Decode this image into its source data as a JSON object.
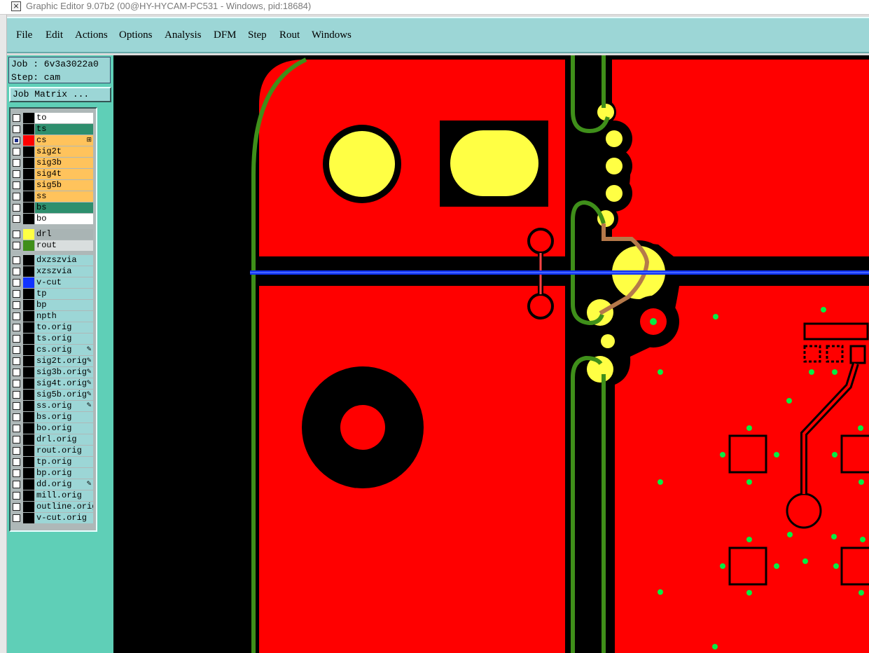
{
  "window": {
    "title": "Graphic Editor 9.07b2 (00@HY-HYCAM-PC531 - Windows, pid:18684)",
    "icon": "editor-icon"
  },
  "menu": [
    "File",
    "Edit",
    "Actions",
    "Options",
    "Analysis",
    "DFM",
    "Step",
    "Rout",
    "Windows"
  ],
  "job": {
    "job_label": "Job : 6v3a3022a0",
    "step_label": "Step: cam",
    "matrix_button": "Job Matrix ..."
  },
  "layers": {
    "board": [
      {
        "name": "to",
        "color": "#ffffff",
        "swatch": "#000000",
        "checked": false
      },
      {
        "name": "ts",
        "color": "#2e8f6e",
        "swatch": "#000000",
        "checked": false
      },
      {
        "name": "cs",
        "color": "#ffc35c",
        "swatch": "#ff0000",
        "checked": true,
        "mark": "⊞"
      },
      {
        "name": "sig2t",
        "color": "#ffc35c",
        "swatch": "#000000",
        "checked": false
      },
      {
        "name": "sig3b",
        "color": "#ffc35c",
        "swatch": "#000000",
        "checked": false
      },
      {
        "name": "sig4t",
        "color": "#ffc35c",
        "swatch": "#000000",
        "checked": false
      },
      {
        "name": "sig5b",
        "color": "#ffc35c",
        "swatch": "#000000",
        "checked": false
      },
      {
        "name": "ss",
        "color": "#ffc35c",
        "swatch": "#000000",
        "checked": false
      },
      {
        "name": "bs",
        "color": "#2e8f6e",
        "swatch": "#000000",
        "checked": false
      },
      {
        "name": "bo",
        "color": "#ffffff",
        "swatch": "#000000",
        "checked": false
      }
    ],
    "drill": [
      {
        "name": "drl",
        "color": "#a9b4b4",
        "swatch": "#ffff44",
        "checked": false
      },
      {
        "name": "rout",
        "color": "#d9dede",
        "swatch": "#3f8f1a",
        "checked": false
      }
    ],
    "misc": [
      {
        "name": "dxzszvia",
        "color": "#9cd6d6",
        "swatch": "#000000",
        "checked": false
      },
      {
        "name": "xzszvia",
        "color": "#9cd6d6",
        "swatch": "#000000",
        "checked": false
      },
      {
        "name": "v-cut",
        "color": "#9cd6d6",
        "swatch": "#1133ff",
        "checked": false
      },
      {
        "name": "tp",
        "color": "#9cd6d6",
        "swatch": "#000000",
        "checked": false
      },
      {
        "name": "bp",
        "color": "#9cd6d6",
        "swatch": "#000000",
        "checked": false
      },
      {
        "name": "npth",
        "color": "#9cd6d6",
        "swatch": "#000000",
        "checked": false
      },
      {
        "name": "to.orig",
        "color": "#9cd6d6",
        "swatch": "#000000",
        "checked": false
      },
      {
        "name": "ts.orig",
        "color": "#9cd6d6",
        "swatch": "#000000",
        "checked": false
      },
      {
        "name": "cs.orig",
        "color": "#9cd6d6",
        "swatch": "#000000",
        "checked": false,
        "mark": "✎"
      },
      {
        "name": "sig2t.orig",
        "color": "#9cd6d6",
        "swatch": "#000000",
        "checked": false,
        "mark": "✎"
      },
      {
        "name": "sig3b.orig",
        "color": "#9cd6d6",
        "swatch": "#000000",
        "checked": false,
        "mark": "✎"
      },
      {
        "name": "sig4t.orig",
        "color": "#9cd6d6",
        "swatch": "#000000",
        "checked": false,
        "mark": "✎"
      },
      {
        "name": "sig5b.orig",
        "color": "#9cd6d6",
        "swatch": "#000000",
        "checked": false,
        "mark": "✎"
      },
      {
        "name": "ss.orig",
        "color": "#9cd6d6",
        "swatch": "#000000",
        "checked": false,
        "mark": "✎"
      },
      {
        "name": "bs.orig",
        "color": "#9cd6d6",
        "swatch": "#000000",
        "checked": false
      },
      {
        "name": "bo.orig",
        "color": "#9cd6d6",
        "swatch": "#000000",
        "checked": false
      },
      {
        "name": "drl.orig",
        "color": "#9cd6d6",
        "swatch": "#000000",
        "checked": false
      },
      {
        "name": "rout.orig",
        "color": "#9cd6d6",
        "swatch": "#000000",
        "checked": false
      },
      {
        "name": "tp.orig",
        "color": "#9cd6d6",
        "swatch": "#000000",
        "checked": false
      },
      {
        "name": "bp.orig",
        "color": "#9cd6d6",
        "swatch": "#000000",
        "checked": false
      },
      {
        "name": "dd.orig",
        "color": "#9cd6d6",
        "swatch": "#000000",
        "checked": false,
        "mark": "✎"
      },
      {
        "name": "mill.orig",
        "color": "#9cd6d6",
        "swatch": "#000000",
        "checked": false
      },
      {
        "name": "outline.orig",
        "color": "#9cd6d6",
        "swatch": "#000000",
        "checked": false
      },
      {
        "name": "v-cut.orig",
        "color": "#9cd6d6",
        "swatch": "#000000",
        "checked": false
      }
    ]
  },
  "colors": {
    "copper": "#ff0000",
    "drill": "#ffff44",
    "rout": "#3f8f1a",
    "vcut": "#1133ff",
    "smd": "#00ee44",
    "background": "#000000",
    "panel": "#5fcfb7",
    "menubar": "#9cd6d6"
  }
}
